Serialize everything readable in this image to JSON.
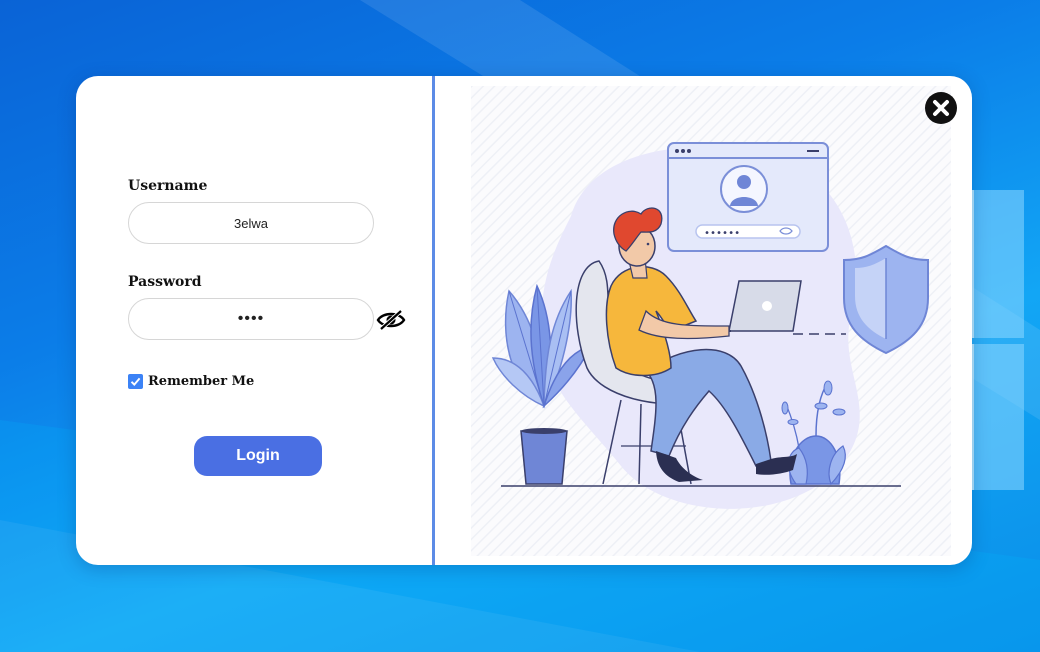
{
  "login_form": {
    "username_label": "Username",
    "username_value": "3elwa",
    "password_label": "Password",
    "password_value": "••••",
    "remember_label": "Remember Me",
    "remember_checked": true,
    "login_label": "Login"
  },
  "icons": {
    "close": "close-icon",
    "password_visibility": "eye-slash-icon",
    "checkbox": "check-icon"
  },
  "illustration": {
    "subject": "person-using-laptop-login-security",
    "password_dots": "••••••"
  },
  "colors": {
    "accent": "#4a6fe3",
    "divider": "#5c8be6",
    "checkbox": "#3b82f6"
  }
}
